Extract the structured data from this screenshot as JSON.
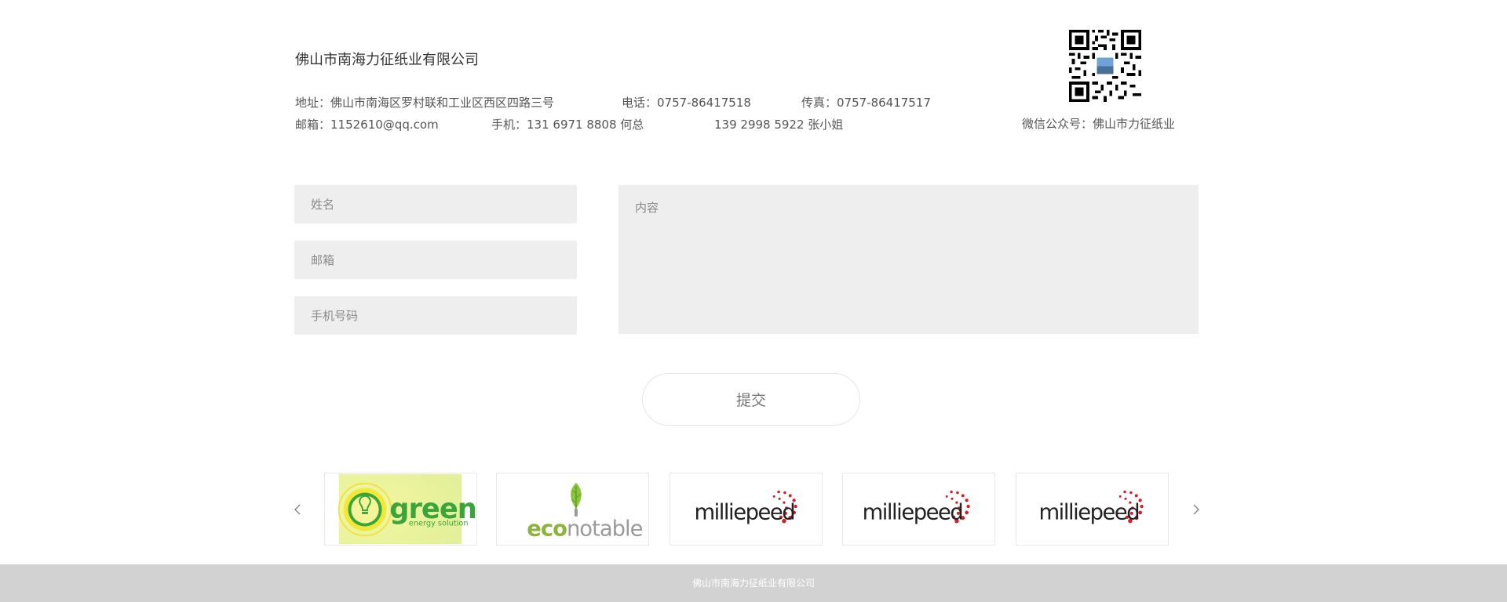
{
  "contact": {
    "company_name": "佛山市南海力征纸业有限公司",
    "address": "地址：佛山市南海区罗村联和工业区西区四路三号",
    "phone": "电话：0757-86417518",
    "fax": "传真：0757-86417517",
    "email": "邮箱：1152610@qq.com",
    "mobile1": "手机：131 6971 8808  何总",
    "mobile2": "139 2998 5922  张小姐",
    "wechat": "微信公众号：佛山市力征纸业"
  },
  "form": {
    "name_placeholder": "姓名",
    "email_placeholder": "邮箱",
    "phone_placeholder": "手机号码",
    "content_placeholder": "内容",
    "submit_label": "提交"
  },
  "partners": {
    "logos": [
      {
        "main": "green",
        "sub": "energy solution"
      },
      {
        "main_prefix": "eco",
        "main_suffix": "notable"
      },
      {
        "main": "milliepeed"
      },
      {
        "main": "milliepeed"
      },
      {
        "main": "milliepeed"
      }
    ],
    "icons": {
      "prev": "chevron-left-icon",
      "next": "chevron-right-icon"
    }
  },
  "colors": {
    "input_bg": "#eeeeee",
    "footer_bg": "#d2d2d2",
    "green_logo": "#3aa53a",
    "eco_green": "#8cb43c",
    "milliepeed_red": "#d0202a"
  },
  "footer": {
    "text": "佛山市南海力征纸业有限公司"
  }
}
